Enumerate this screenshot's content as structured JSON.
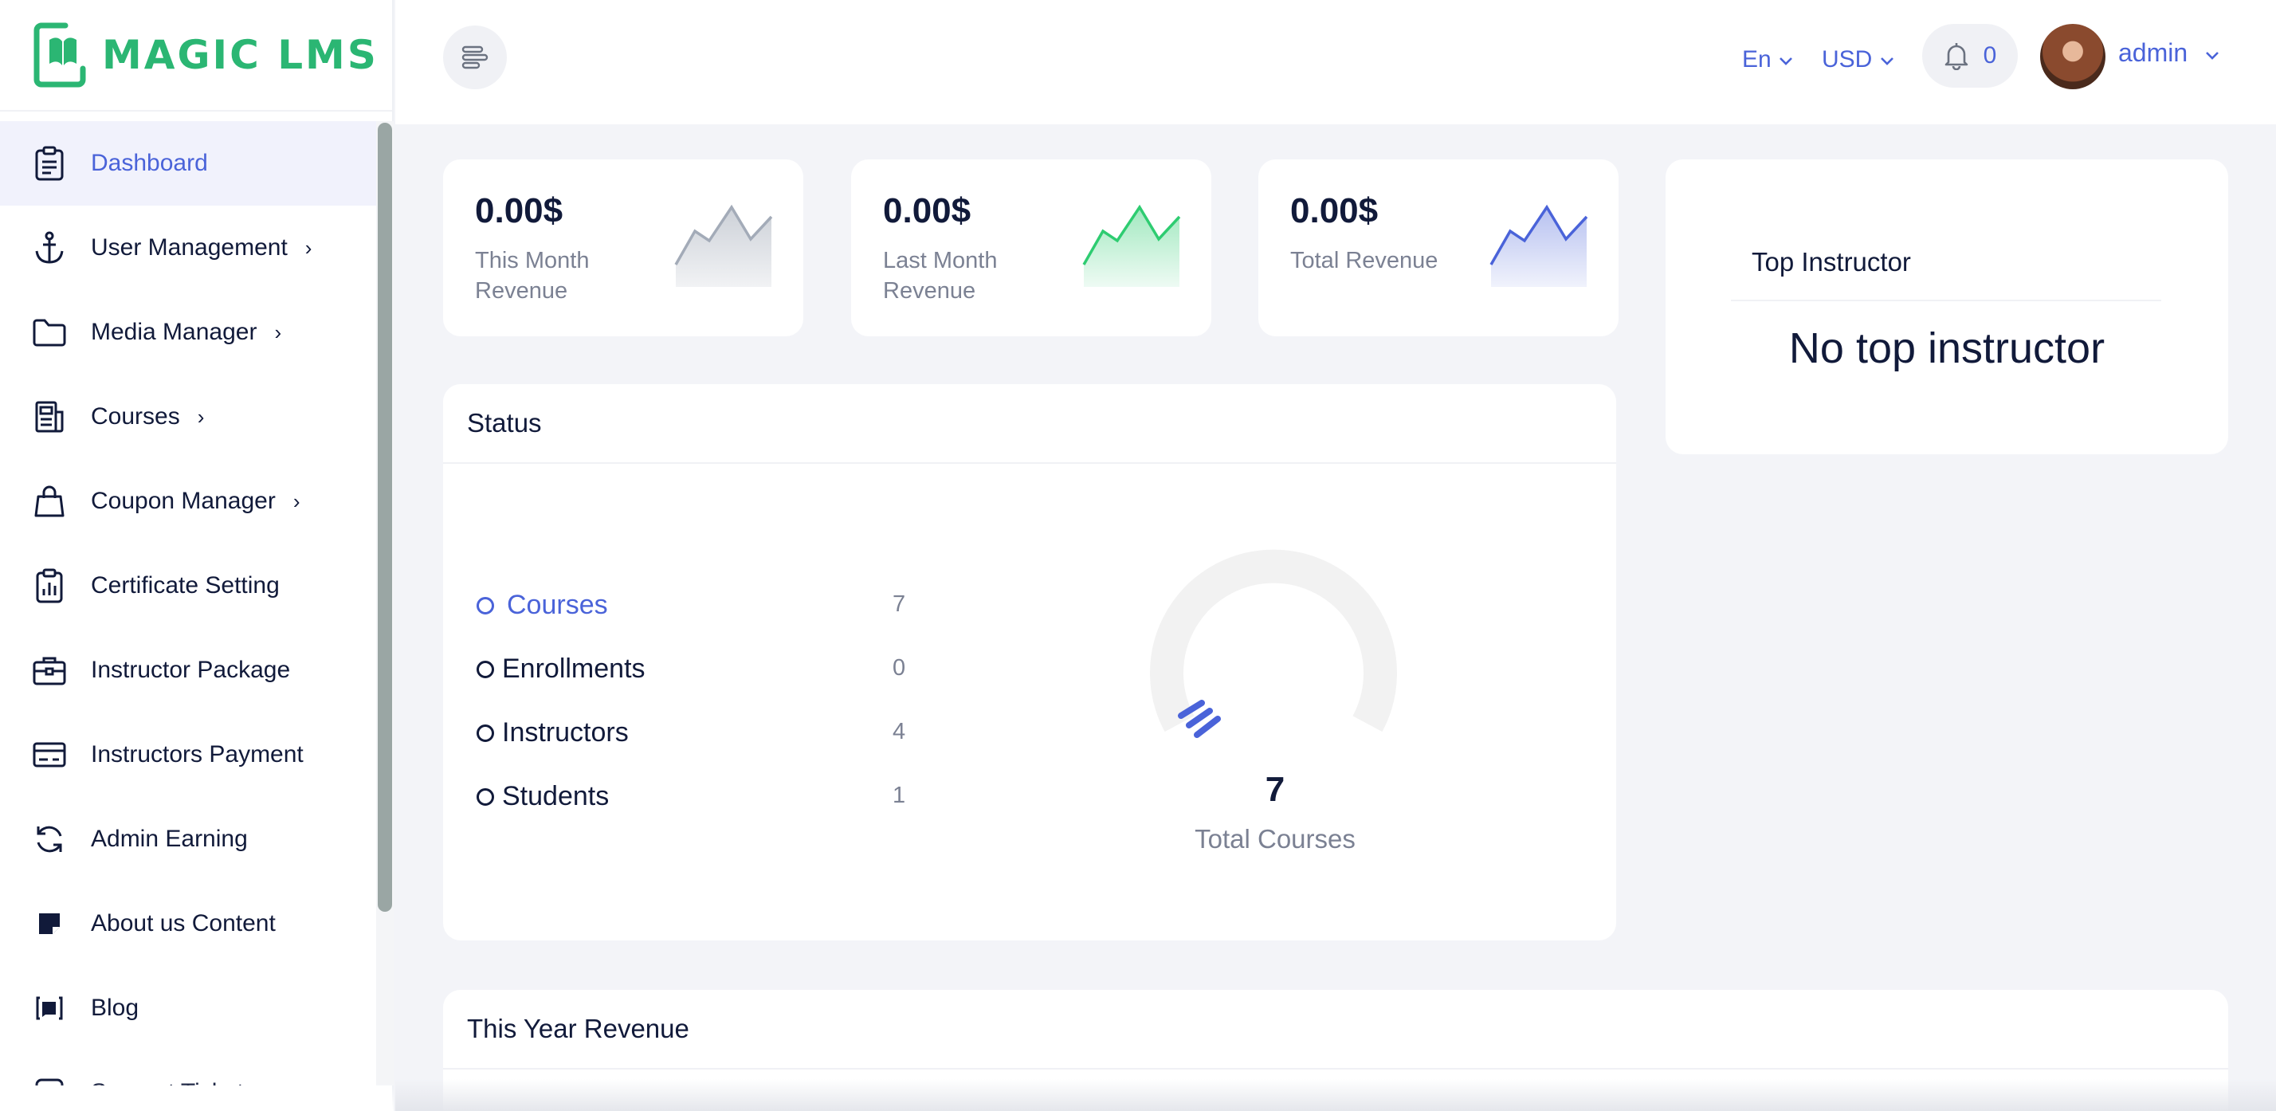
{
  "brand": {
    "name": "MAGIC LMS",
    "color": "#2bb673"
  },
  "accent": "#4a63d9",
  "sidebar": {
    "items": [
      {
        "label": "Dashboard",
        "icon": "clipboard-icon",
        "active": true
      },
      {
        "label": "User Management",
        "icon": "anchor-icon",
        "chevron": true
      },
      {
        "label": "Media Manager",
        "icon": "folder-icon",
        "chevron": true
      },
      {
        "label": "Courses",
        "icon": "newspaper-icon",
        "chevron": true
      },
      {
        "label": "Coupon Manager",
        "icon": "shopping-bag-icon",
        "chevron": true
      },
      {
        "label": "Certificate Setting",
        "icon": "clipboard-chart-icon"
      },
      {
        "label": "Instructor Package",
        "icon": "briefcase-icon"
      },
      {
        "label": "Instructors Payment",
        "icon": "credit-card-icon"
      },
      {
        "label": "Admin Earning",
        "icon": "refresh-icon"
      },
      {
        "label": "About us Content",
        "icon": "sticky-note-icon"
      },
      {
        "label": "Blog",
        "icon": "blog-icon"
      },
      {
        "label": "Support Ticket",
        "icon": "chat-icon"
      }
    ]
  },
  "header": {
    "language": "En",
    "currency": "USD",
    "notifications": "0",
    "user": "admin"
  },
  "revenue_cards": [
    {
      "value": "0.00$",
      "label": "This Month Revenue",
      "color": "#a3abb8"
    },
    {
      "value": "0.00$",
      "label": "Last Month Revenue",
      "color": "#2ecc71"
    },
    {
      "value": "0.00$",
      "label": "Total Revenue",
      "color": "#4a63d9"
    }
  ],
  "top_instructor": {
    "title": "Top Instructor",
    "empty_text": "No top instructor"
  },
  "status": {
    "title": "Status",
    "rows": [
      {
        "label": "Courses",
        "value": "7",
        "active": true
      },
      {
        "label": "Enrollments",
        "value": "0"
      },
      {
        "label": "Instructors",
        "value": "4"
      },
      {
        "label": "Students",
        "value": "1"
      }
    ],
    "total_value": "7",
    "total_label": "Total Courses"
  },
  "year_revenue": {
    "title": "This Year Revenue"
  }
}
